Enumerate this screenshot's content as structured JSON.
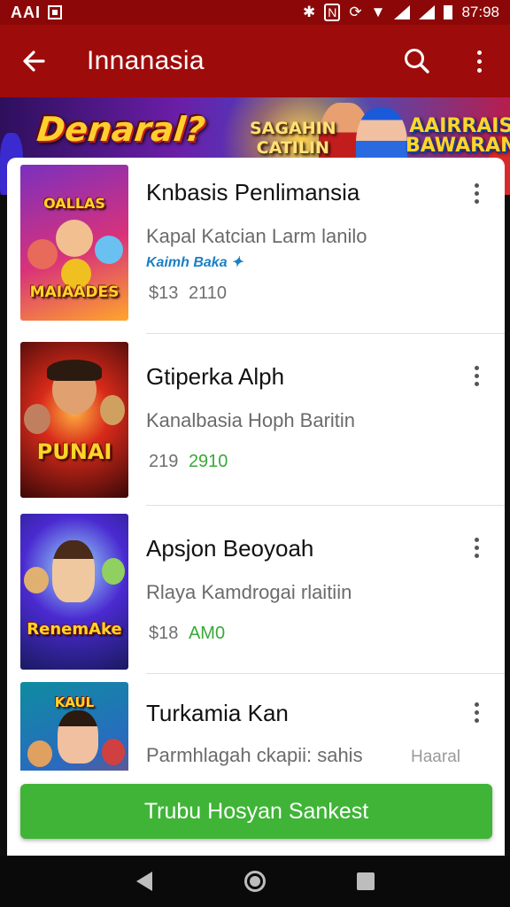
{
  "status_bar": {
    "carrier": "AAI",
    "time": "87:98"
  },
  "app_bar": {
    "title": "Innanasia"
  },
  "banner": {
    "title": "Denaral?",
    "badge_1": "SAGAHIN\nCATILIN",
    "badge_2": "AAIRRAIS\nBAWARAN"
  },
  "items": [
    {
      "title": "Knbasis Penlimansia",
      "subtitle": "Kapal Katcian Larm lanilo",
      "tag": "Kaimh Baka",
      "price": "$13",
      "count": "2110",
      "count_color": "gray",
      "thumb_label": "MAIAADES",
      "thumb_top": "OALLAS",
      "thumb_colors": [
        "#8a1f9c",
        "#e0345f",
        "#ffb020"
      ]
    },
    {
      "title": "Gtiperka Alph",
      "subtitle": "Kanalbasia Hoph Baritin",
      "price": "219",
      "count": "2910",
      "count_color": "green",
      "thumb_label": "PUNAI",
      "thumb_colors": [
        "#3a0a0a",
        "#b81d1d",
        "#ff7a1a"
      ]
    },
    {
      "title": "Apsjon Beoyoah",
      "subtitle": "Rlaya Kamdrogai rlaitiin",
      "price": "$18",
      "count": "AM0",
      "count_color": "green",
      "thumb_label": "RenemAke",
      "thumb_colors": [
        "#1b1f6b",
        "#6b22c7",
        "#f0a020"
      ]
    },
    {
      "title": "Turkamia Kan",
      "subtitle": "Parmhlagah ckapii: sahis",
      "extra": "Haaral",
      "thumb_label": "KAUL",
      "thumb_colors": [
        "#0e6b7a",
        "#e03a3a",
        "#ffd020"
      ]
    }
  ],
  "cta": {
    "label": "Trubu Hosyan Sankest"
  },
  "icons": {
    "back": "arrow-back-icon",
    "search": "search-icon",
    "overflow": "more-vert-icon",
    "nav_back": "triangle-back-icon",
    "nav_home": "circle-home-icon",
    "nav_recents": "square-recents-icon"
  },
  "colors": {
    "app_bar": "#9e0b0b",
    "cta": "#3fb437",
    "tag": "#1b7fc4",
    "count_green": "#3aa83a"
  }
}
